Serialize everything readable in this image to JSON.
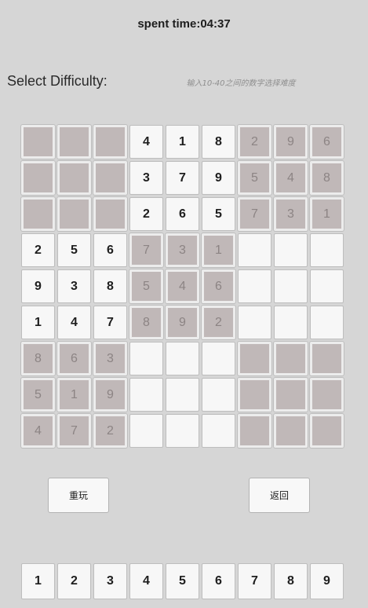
{
  "timer": {
    "text": "spent time:04:37"
  },
  "difficulty": {
    "label": "Select Difficulty:",
    "placeholder": "输入10-40之间的数字选择难度"
  },
  "board": {
    "rows": [
      [
        "",
        "",
        "",
        "4",
        "1",
        "8",
        "2",
        "9",
        "6"
      ],
      [
        "",
        "",
        "",
        "3",
        "7",
        "9",
        "5",
        "4",
        "8"
      ],
      [
        "",
        "",
        "",
        "2",
        "6",
        "5",
        "7",
        "3",
        "1"
      ],
      [
        "2",
        "5",
        "6",
        "7",
        "3",
        "1",
        "",
        "",
        ""
      ],
      [
        "9",
        "3",
        "8",
        "5",
        "4",
        "6",
        "",
        "",
        ""
      ],
      [
        "1",
        "4",
        "7",
        "8",
        "9",
        "2",
        "",
        "",
        ""
      ],
      [
        "8",
        "6",
        "3",
        "",
        "",
        "",
        "",
        "",
        ""
      ],
      [
        "5",
        "1",
        "9",
        "",
        "",
        "",
        "",
        "",
        ""
      ],
      [
        "4",
        "7",
        "2",
        "",
        "",
        "",
        "",
        "",
        ""
      ]
    ],
    "shaded": [
      [
        true,
        true,
        true,
        false,
        false,
        false,
        true,
        true,
        true
      ],
      [
        true,
        true,
        true,
        false,
        false,
        false,
        true,
        true,
        true
      ],
      [
        true,
        true,
        true,
        false,
        false,
        false,
        true,
        true,
        true
      ],
      [
        false,
        false,
        false,
        true,
        true,
        true,
        false,
        false,
        false
      ],
      [
        false,
        false,
        false,
        true,
        true,
        true,
        false,
        false,
        false
      ],
      [
        false,
        false,
        false,
        true,
        true,
        true,
        false,
        false,
        false
      ],
      [
        true,
        true,
        true,
        false,
        false,
        false,
        true,
        true,
        true
      ],
      [
        true,
        true,
        true,
        false,
        false,
        false,
        true,
        true,
        true
      ],
      [
        true,
        true,
        true,
        false,
        false,
        false,
        true,
        true,
        true
      ]
    ]
  },
  "buttons": {
    "restart": "重玩",
    "back": "返回"
  },
  "number_pad": [
    "1",
    "2",
    "3",
    "4",
    "5",
    "6",
    "7",
    "8",
    "9"
  ],
  "colors": {
    "background": "#d6d6d6",
    "cell_white": "#f7f7f7",
    "cell_shaded": "#c0b8b8",
    "shaded_digit": "#8c8484"
  }
}
